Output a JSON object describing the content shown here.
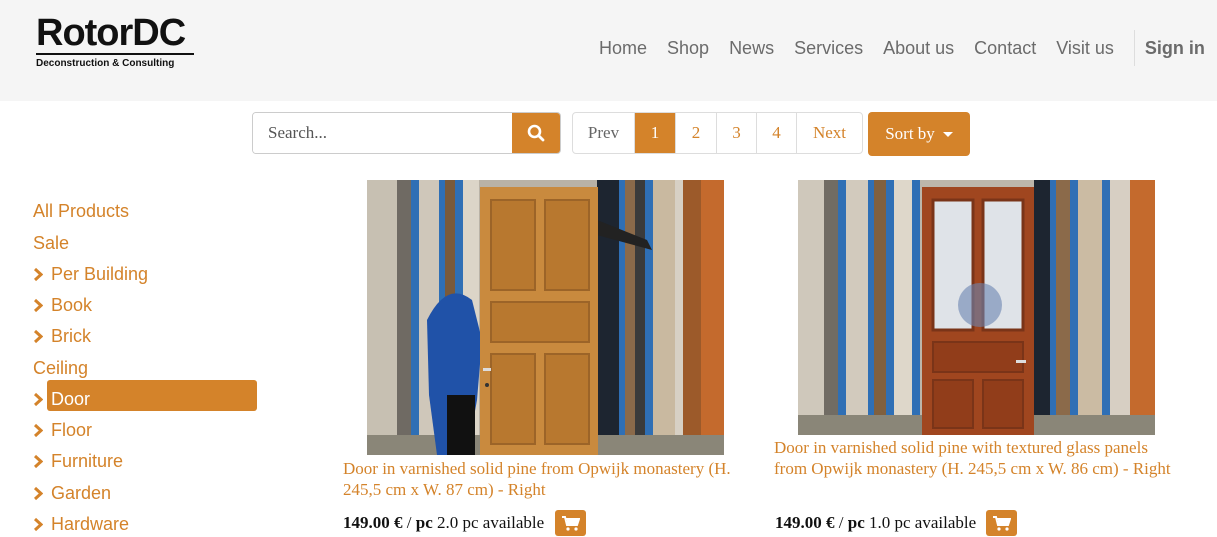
{
  "brand": {
    "name": "RotorDC",
    "tagline": "Deconstruction & Consulting"
  },
  "nav": {
    "items": [
      "Home",
      "Shop",
      "News",
      "Services",
      "About us",
      "Contact",
      "Visit us"
    ],
    "signin": "Sign in"
  },
  "search": {
    "placeholder": "Search...",
    "value": ""
  },
  "pager": {
    "prev": "Prev",
    "pages": [
      "1",
      "2",
      "3",
      "4"
    ],
    "current": "1",
    "next": "Next"
  },
  "sort": {
    "label": "Sort by"
  },
  "categories": [
    {
      "label": "All Products",
      "expandable": false
    },
    {
      "label": "Sale",
      "expandable": false
    },
    {
      "label": "Per Building",
      "expandable": true
    },
    {
      "label": "Book",
      "expandable": true
    },
    {
      "label": "Brick",
      "expandable": true
    },
    {
      "label": "Ceiling",
      "expandable": false
    },
    {
      "label": "Door",
      "expandable": true,
      "active": true
    },
    {
      "label": "Floor",
      "expandable": true
    },
    {
      "label": "Furniture",
      "expandable": true
    },
    {
      "label": "Garden",
      "expandable": true
    },
    {
      "label": "Hardware",
      "expandable": true
    }
  ],
  "products": [
    {
      "title": "Door in varnished solid pine from Opwijk monastery (H. 245,5 cm x W. 87 cm) - Right",
      "price": "149.00 €",
      "unit": "pc",
      "available": "2.0 pc available",
      "image": "door-pine-photo"
    },
    {
      "title": "Door in varnished solid pine with textured glass panels from Opwijk monastery (H. 245,5 cm x W. 86 cm) - Right",
      "price": "149.00 €",
      "unit": "pc",
      "available": "1.0 pc available",
      "image": "door-glass-photo"
    }
  ],
  "colors": {
    "accent": "#d4832a",
    "header_bg": "#f5f5f5",
    "nav_text": "#6b6b6b"
  }
}
